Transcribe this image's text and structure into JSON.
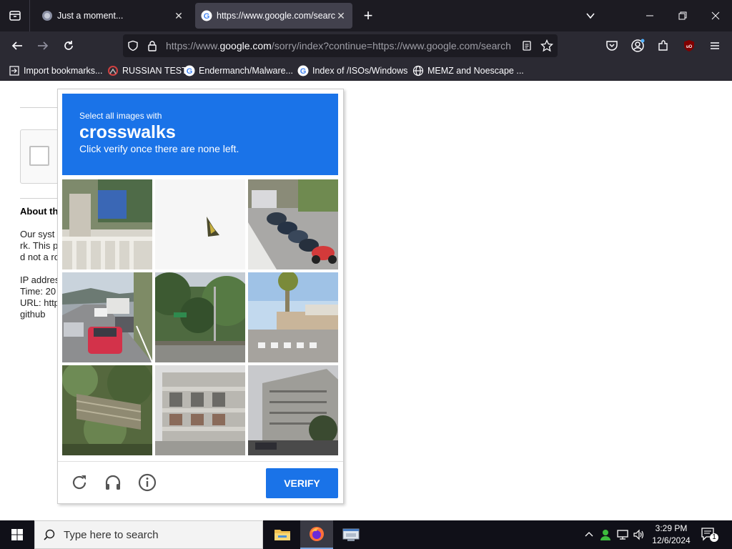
{
  "browser": {
    "tabs": [
      {
        "title": "Just a moment...",
        "active": false
      },
      {
        "title": "https://www.google.com/searc",
        "active": true
      }
    ],
    "url": {
      "prefix": "https://www.",
      "host": "google.com",
      "rest": "/sorry/index?continue=https://www.google.com/search"
    },
    "bookmarks": [
      {
        "label": "Import bookmarks...",
        "icon": "import-icon"
      },
      {
        "label": "RUSSIAN TEST",
        "icon": "russian-test-favicon"
      },
      {
        "label": "Endermanch/Malware...",
        "icon": "google-favicon"
      },
      {
        "label": "Index of /ISOs/Windows",
        "icon": "google-favicon"
      },
      {
        "label": "MEMZ and Noescape ...",
        "icon": "globe-icon"
      }
    ]
  },
  "page": {
    "about_title": "About th",
    "text_lines": [
      "Our syst",
      "rk. This p",
      "d not a ro",
      "IP addres",
      "Time: 20",
      "URL: http",
      "github"
    ]
  },
  "challenge": {
    "instruction_small": "Select all images with",
    "target": "crosswalks",
    "instruction_sub": "Click verify once there are none left.",
    "verify_label": "VERIFY",
    "accent": "#1a73e8"
  },
  "taskbar": {
    "search_placeholder": "Type here to search",
    "time": "3:29 PM",
    "date": "12/6/2024",
    "notification_count": "1"
  }
}
